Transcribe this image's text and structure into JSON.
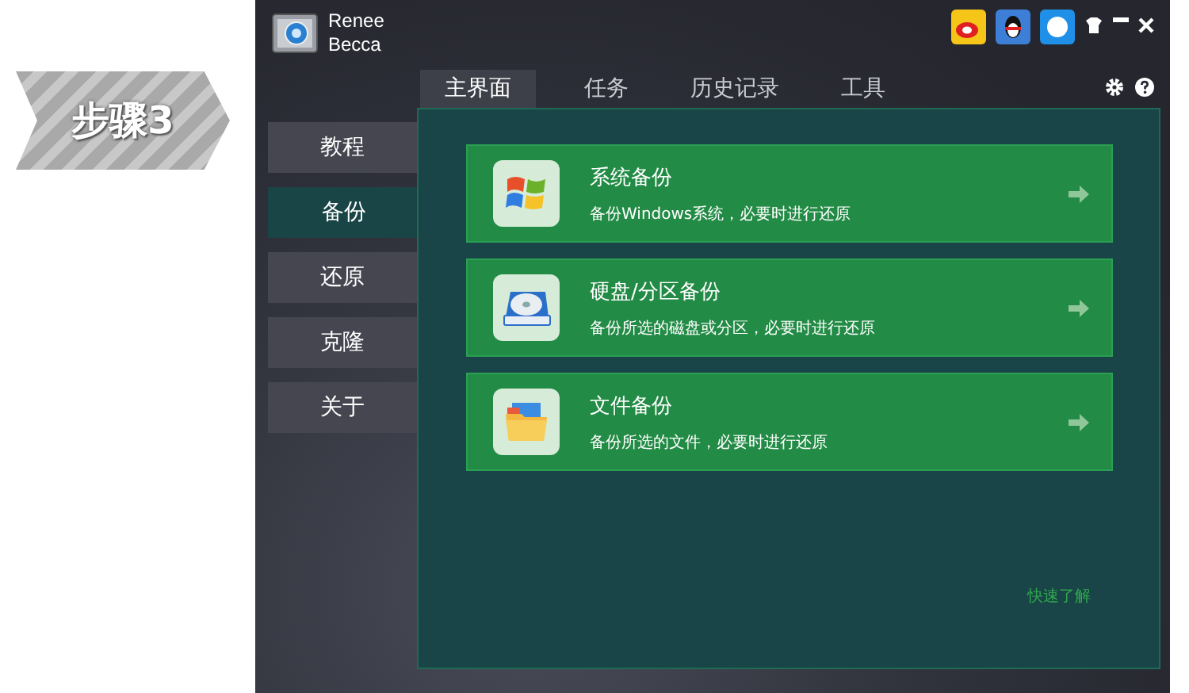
{
  "step_badge": {
    "label": "步骤3"
  },
  "window": {
    "title_lines": [
      "Renee",
      "Becca"
    ]
  },
  "tabs": [
    {
      "label": "主界面",
      "selected": true
    },
    {
      "label": "任务",
      "selected": false
    },
    {
      "label": "历史记录",
      "selected": false
    },
    {
      "label": "工具",
      "selected": false
    }
  ],
  "sidebar": {
    "items": [
      {
        "label": "教程",
        "selected": false
      },
      {
        "label": "备份",
        "selected": true
      },
      {
        "label": "还原",
        "selected": false
      },
      {
        "label": "克隆",
        "selected": false
      },
      {
        "label": "关于",
        "selected": false
      }
    ]
  },
  "cards": [
    {
      "kind": "windows",
      "title": "系统备份",
      "description": "备份Windows系统，必要时进行还原"
    },
    {
      "kind": "disk",
      "title": "硬盘/分区备份",
      "description": "备份所选的磁盘或分区，必要时进行还原"
    },
    {
      "kind": "folder",
      "title": "文件备份",
      "description": "备份所选的文件，必要时进行还原"
    }
  ],
  "quick_link": "快速了解"
}
